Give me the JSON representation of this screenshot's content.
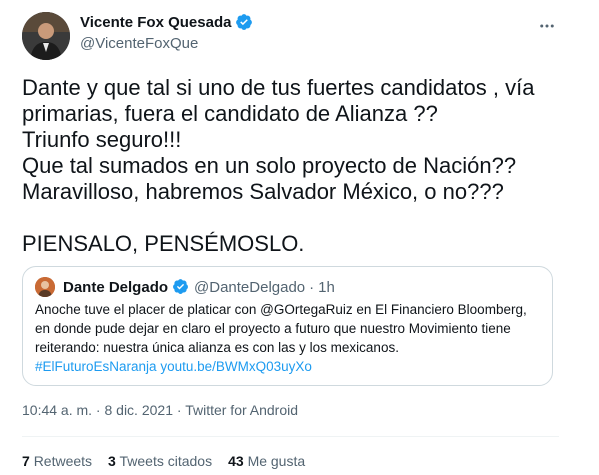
{
  "author": {
    "name": "Vicente Fox Quesada",
    "handle": "@VicenteFoxQue"
  },
  "more_icon": "more-options-icon",
  "tweet": {
    "lines": [
      "Dante y que tal si uno de tus fuertes candidatos , vía",
      "primarias,  fuera el candidato de Alianza ??",
      "Triunfo seguro!!!",
      "Que tal sumados en un solo proyecto de Nación??",
      "Maravilloso, habremos Salvador México, o no???",
      "",
      "PIENSALO, PENSÉMOSLO."
    ]
  },
  "quote": {
    "name": "Dante Delgado",
    "handle": "@DanteDelgado",
    "separator": "·",
    "time": "1h",
    "line1": "Anoche tuve el placer de platicar con @GOrtegaRuiz en El Financiero Bloomberg,",
    "line2": "en donde pude dejar en claro el proyecto a futuro que nuestro Movimiento tiene",
    "line3": "reiterando: nuestra única alianza es con las y los mexicanos.",
    "hashtag": "#ElFuturoEsNaranja",
    "link": "youtu.be/BWMxQ03uyXo"
  },
  "meta": {
    "datetime": "10:44 a. m. · 8 dic. 2021",
    "separator": "·",
    "source": "Twitter for Android"
  },
  "stats": {
    "retweets_count": "7",
    "retweets_label": "Retweets",
    "quotes_count": "3",
    "quotes_label": "Tweets citados",
    "likes_count": "43",
    "likes_label": "Me gusta"
  },
  "colors": {
    "verified": "#1d9bf0",
    "link": "#1d9bf0",
    "secondary_text": "#536471",
    "border": "#cfd9de"
  }
}
